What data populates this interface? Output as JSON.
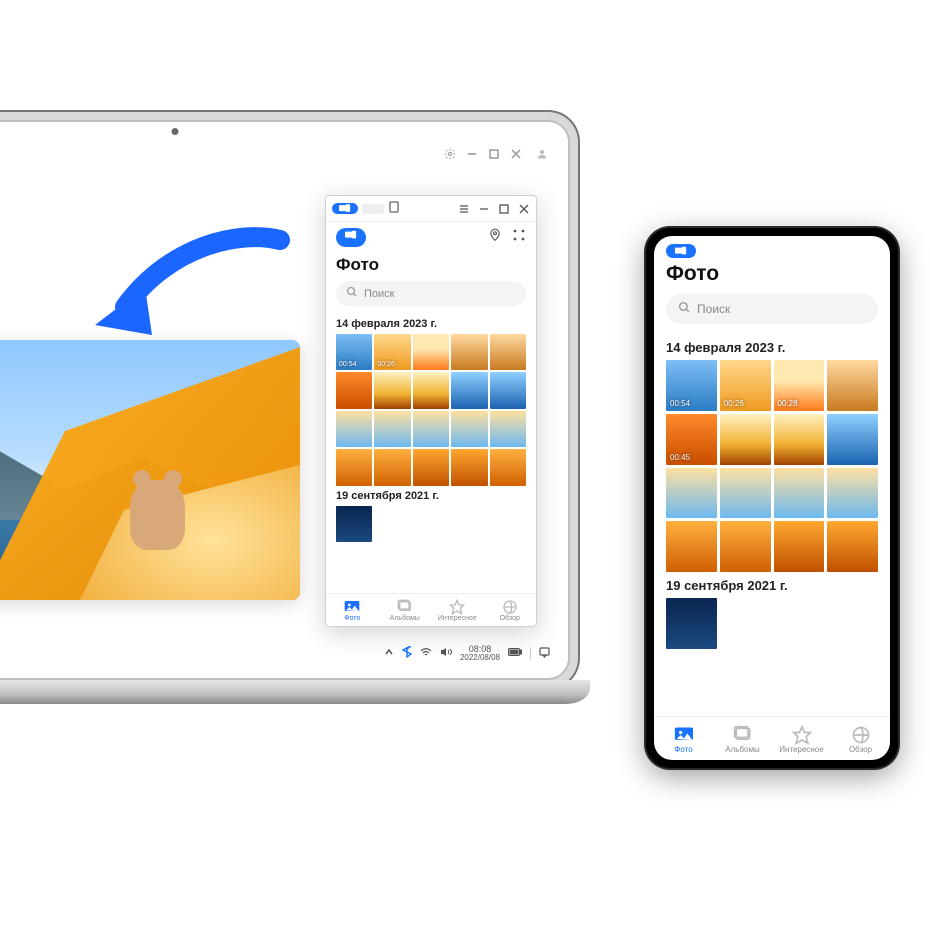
{
  "gallery": {
    "title": "Фото",
    "search_placeholder": "Поиск",
    "sections": [
      {
        "heading": "14 февраля 2023 г."
      },
      {
        "heading": "19 сентября 2021 г."
      }
    ],
    "thumb_durations": {
      "v1": "00:54",
      "v2": "00:26",
      "v3": "00:28",
      "v4": "00:45"
    },
    "nav": {
      "photos": "Фото",
      "albums": "Альбомы",
      "moments": "Интересное",
      "browse": "Обзор"
    }
  },
  "taskbar": {
    "time": "08:08",
    "date": "2022/08/08"
  },
  "colors": {
    "accent": "#1a73ff"
  }
}
